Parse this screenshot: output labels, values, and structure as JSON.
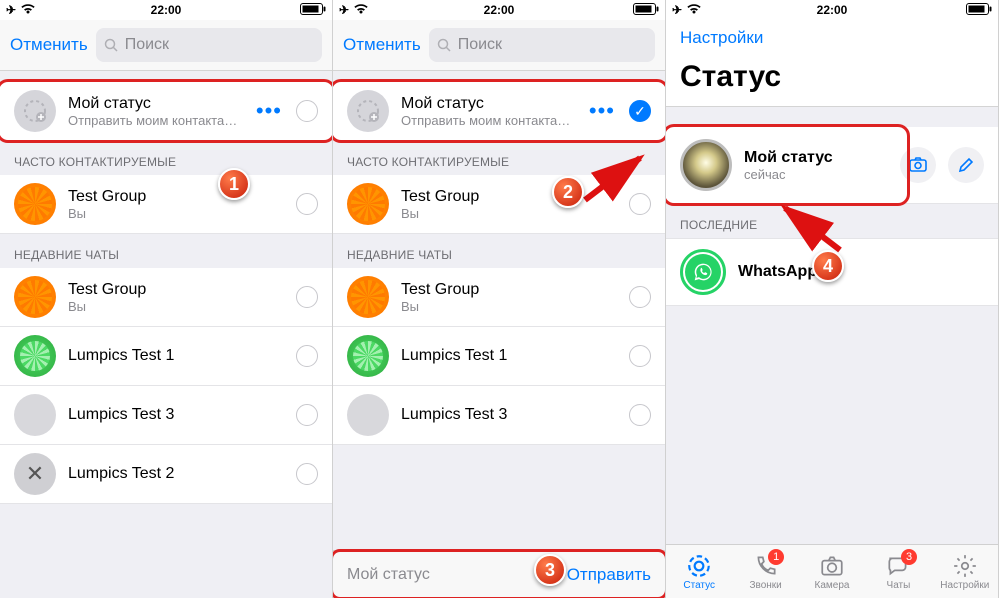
{
  "status_bar": {
    "time": "22:00"
  },
  "panel12": {
    "cancel": "Отменить",
    "search_placeholder": "Поиск",
    "my_status": {
      "title": "Мой статус",
      "subtitle": "Отправить моим контактам, кр…"
    },
    "section_frequent": "ЧАСТО КОНТАКТИРУЕМЫЕ",
    "section_recent": "НЕДАВНИЕ ЧАТЫ",
    "contacts_frequent": [
      {
        "name": "Test Group",
        "sub": "Вы",
        "avatar": "orange"
      }
    ],
    "contacts_recent": [
      {
        "name": "Test Group",
        "sub": "Вы",
        "avatar": "orange"
      },
      {
        "name": "Lumpics Test 1",
        "sub": "",
        "avatar": "green"
      },
      {
        "name": "Lumpics Test 3",
        "sub": "",
        "avatar": "grey"
      },
      {
        "name": "Lumpics Test 2",
        "sub": "",
        "avatar": "tool"
      }
    ],
    "footer": {
      "label": "Мой статус",
      "send": "Отправить"
    }
  },
  "panel3": {
    "back": "Настройки",
    "title": "Статус",
    "my_status": {
      "title": "Мой статус",
      "subtitle": "сейчас"
    },
    "section_recent": "ПОСЛЕДНИЕ",
    "recent_item": {
      "name": "WhatsApp"
    },
    "tabs": {
      "status": "Статус",
      "calls": "Звонки",
      "camera": "Камера",
      "chats": "Чаты",
      "settings": "Настройки",
      "calls_badge": "1",
      "chats_badge": "3"
    }
  },
  "annotations": {
    "b1": "1",
    "b2": "2",
    "b3": "3",
    "b4": "4"
  }
}
